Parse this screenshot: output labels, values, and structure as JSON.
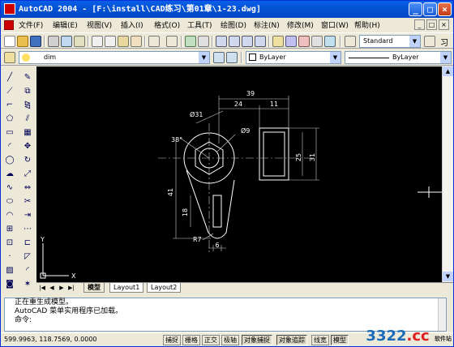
{
  "window": {
    "title": "AutoCAD 2004 - [F:\\install\\CAD练习\\第01章\\1-23.dwg]",
    "minimize_glyph": "_",
    "maximize_glyph": "□",
    "close_glyph": "×"
  },
  "menu": {
    "items": [
      "文件(F)",
      "编辑(E)",
      "视图(V)",
      "插入(I)",
      "格式(O)",
      "工具(T)",
      "绘图(D)",
      "标注(N)",
      "修改(M)",
      "窗口(W)",
      "帮助(H)"
    ]
  },
  "toolbar": {
    "text_style": "Standard",
    "tail_glyph": "习"
  },
  "layers": {
    "current_layer": "dim",
    "color": "ByLayer",
    "linetype": "ByLayer"
  },
  "drawing": {
    "dims": [
      "39",
      "24",
      "11",
      "Ø31",
      "38°",
      "Ø9",
      "25",
      "31",
      "41",
      "18",
      "R7",
      "6"
    ],
    "ucs_x": "X",
    "ucs_y": "Y"
  },
  "tabs": {
    "nav_glyphs": [
      "|◀",
      "◀",
      "▶",
      "▶|"
    ],
    "items": [
      "模型",
      "Layout1",
      "Layout2"
    ]
  },
  "command": {
    "lines": [
      "正在重生成模型。",
      "AutoCAD 菜单实用程序已加载。"
    ],
    "prompt": "命令:"
  },
  "status": {
    "coords": "599.9963, 118.7569, 0.0000",
    "buttons": [
      "捕捉",
      "栅格",
      "正交",
      "极轴",
      "对象捕捉",
      "对象追踪",
      "线宽",
      "模型"
    ]
  },
  "watermark": {
    "prefix": "3322",
    "suffix": ".cc",
    "tag": "软件站"
  },
  "colors": {
    "titlebar": "#0554d6",
    "canvas": "#000000",
    "drawing_lines": "#ffffff"
  }
}
